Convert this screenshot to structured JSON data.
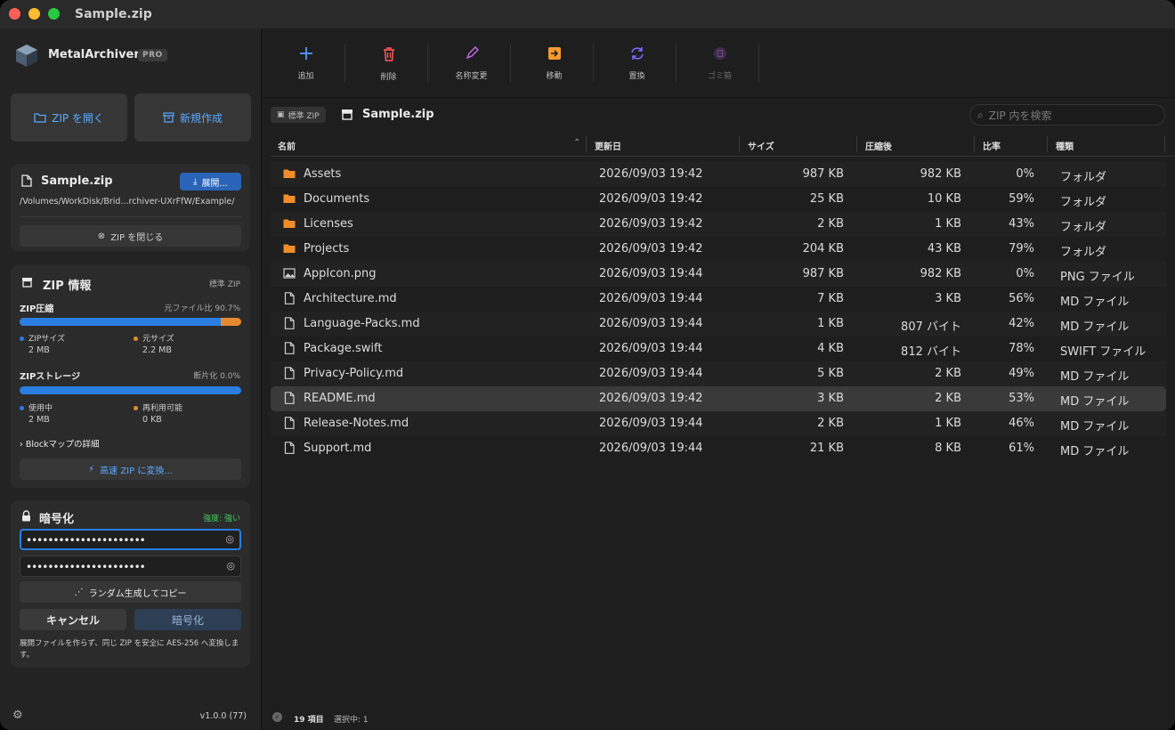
{
  "window": {
    "title": "Sample.zip"
  },
  "colors": {
    "accent": "#2a7de1",
    "orange": "#e58a2f",
    "green": "#3ecf5b",
    "folder": "#f28c2a"
  },
  "sidebar": {
    "app_name": "MetalArchiver",
    "badge": "PRO",
    "open_zip": "ZIP を開く",
    "new_zip": "新規作成",
    "file": {
      "name": "Sample.zip",
      "extract": "展開...",
      "path": "/Volumes/WorkDisk/Brid...rchiver-UXrFfW/Example/",
      "close": "ZIP を閉じる"
    },
    "info": {
      "title": "ZIP 情報",
      "type": "標準 ZIP",
      "compress_label": "ZIP圧縮",
      "compress_ratio_text": "元ファイル比 90.7%",
      "compress_fraction": 0.907,
      "zip_size_label": "ZIPサイズ",
      "zip_size": "2 MB",
      "orig_size_label": "元サイズ",
      "orig_size": "2.2 MB",
      "storage_label": "ZIPストレージ",
      "fragment_text": "断片化 0.0%",
      "storage_fraction": 1.0,
      "used_label": "使用中",
      "used": "2 MB",
      "reusable_label": "再利用可能",
      "reusable": "0 KB",
      "block_map": "Blockマップの詳細",
      "convert": "高速 ZIP に変換..."
    },
    "encrypt": {
      "title": "暗号化",
      "strength": "強度: 強い",
      "password1": "••••••••••••••••••••••",
      "password2": "••••••••••••••••••••••",
      "random": "ランダム生成してコピー",
      "cancel": "キャンセル",
      "submit": "暗号化",
      "note": "展開ファイルを作らず、同じ ZIP を安全に AES-256 へ変換します。"
    },
    "version": "v1.0.0 (77)"
  },
  "toolbar": {
    "add": "追加",
    "delete": "削除",
    "rename": "名称変更",
    "move": "移動",
    "replace": "置換",
    "trash": "ゴミ箱"
  },
  "pathbar": {
    "chip": "標準 ZIP",
    "current": "Sample.zip",
    "search_placeholder": "ZIP 内を検索"
  },
  "table": {
    "headers": {
      "name": "名前",
      "modified": "更新日",
      "size": "サイズ",
      "compressed": "圧縮後",
      "ratio": "比率",
      "kind": "種類"
    },
    "rows": [
      {
        "icon": "folder-icon",
        "name": "Assets",
        "modified": "2026/09/03 19:42",
        "size": "987 KB",
        "compressed": "982 KB",
        "ratio": "0%",
        "kind": "フォルダ"
      },
      {
        "icon": "folder-icon",
        "name": "Documents",
        "modified": "2026/09/03 19:42",
        "size": "25 KB",
        "compressed": "10 KB",
        "ratio": "59%",
        "kind": "フォルダ"
      },
      {
        "icon": "folder-icon",
        "name": "Licenses",
        "modified": "2026/09/03 19:42",
        "size": "2 KB",
        "compressed": "1 KB",
        "ratio": "43%",
        "kind": "フォルダ"
      },
      {
        "icon": "folder-icon",
        "name": "Projects",
        "modified": "2026/09/03 19:42",
        "size": "204 KB",
        "compressed": "43 KB",
        "ratio": "79%",
        "kind": "フォルダ"
      },
      {
        "icon": "image-icon",
        "name": "AppIcon.png",
        "modified": "2026/09/03 19:44",
        "size": "987 KB",
        "compressed": "982 KB",
        "ratio": "0%",
        "kind": "PNG ファイル"
      },
      {
        "icon": "document-icon",
        "name": "Architecture.md",
        "modified": "2026/09/03 19:44",
        "size": "7 KB",
        "compressed": "3 KB",
        "ratio": "56%",
        "kind": "MD ファイル"
      },
      {
        "icon": "document-icon",
        "name": "Language-Packs.md",
        "modified": "2026/09/03 19:44",
        "size": "1 KB",
        "compressed": "807 バイト",
        "ratio": "42%",
        "kind": "MD ファイル"
      },
      {
        "icon": "document-icon",
        "name": "Package.swift",
        "modified": "2026/09/03 19:44",
        "size": "4 KB",
        "compressed": "812 バイト",
        "ratio": "78%",
        "kind": "SWIFT ファイル"
      },
      {
        "icon": "document-icon",
        "name": "Privacy-Policy.md",
        "modified": "2026/09/03 19:44",
        "size": "5 KB",
        "compressed": "2 KB",
        "ratio": "49%",
        "kind": "MD ファイル"
      },
      {
        "icon": "document-icon",
        "name": "README.md",
        "modified": "2026/09/03 19:42",
        "size": "3 KB",
        "compressed": "2 KB",
        "ratio": "53%",
        "kind": "MD ファイル",
        "selected": true
      },
      {
        "icon": "document-icon",
        "name": "Release-Notes.md",
        "modified": "2026/09/03 19:44",
        "size": "2 KB",
        "compressed": "1 KB",
        "ratio": "46%",
        "kind": "MD ファイル"
      },
      {
        "icon": "document-icon",
        "name": "Support.md",
        "modified": "2026/09/03 19:44",
        "size": "21 KB",
        "compressed": "8 KB",
        "ratio": "61%",
        "kind": "MD ファイル"
      }
    ]
  },
  "status": {
    "count": "19 項目",
    "selection": "選択中: 1"
  }
}
